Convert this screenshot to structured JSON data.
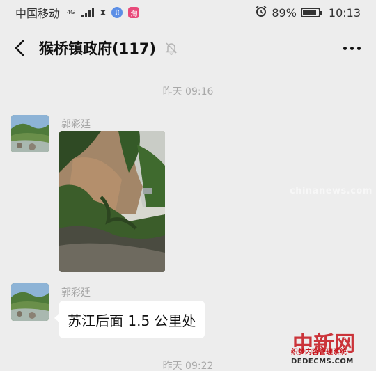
{
  "status_bar": {
    "carrier": "中国移动",
    "network_tag": "4G",
    "battery_percent": "89%",
    "battery_level": 0.89,
    "time": "10:13",
    "icons": [
      "signal-icon",
      "hourglass-icon",
      "music-app-icon",
      "taobao-app-icon",
      "alarm-icon",
      "battery-icon"
    ]
  },
  "header": {
    "title": "猴桥镇政府(117)",
    "icons": [
      "back-arrow-icon",
      "mute-bell-icon",
      "more-dots-icon"
    ]
  },
  "chat": {
    "timestamp_1": "昨天 09:16",
    "timestamp_2": "昨天 09:22",
    "messages": [
      {
        "sender": "郭彩廷",
        "type": "image",
        "image_desc": "landslide"
      },
      {
        "sender": "郭彩廷",
        "type": "text",
        "text": "苏江后面 1.5 公里处"
      }
    ]
  },
  "watermarks": {
    "chinanews_text": "chinanews.com",
    "logo_text": "中新网",
    "dede_line1": "织梦内容管理系统",
    "dede_line2": "DEDECMS.COM"
  },
  "colors": {
    "background": "#ededed",
    "bubble": "#ffffff",
    "timestamp": "#a9a9a9",
    "sender": "#a5a5a5",
    "watermark_red": "#c6141b"
  }
}
